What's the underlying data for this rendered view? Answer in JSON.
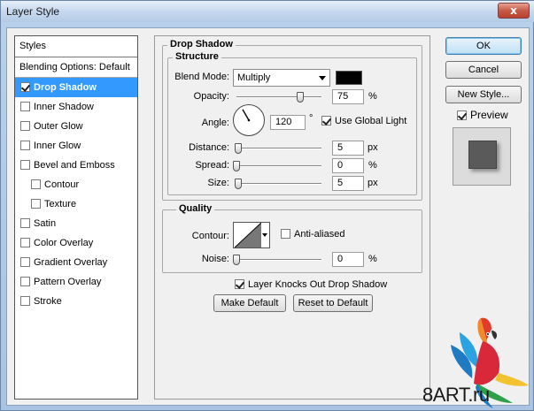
{
  "window": {
    "title": "Layer Style",
    "close_glyph": "x"
  },
  "styles_list": {
    "header": "Styles",
    "blending": "Blending Options: Default",
    "items": [
      {
        "label": "Drop Shadow",
        "checked": true,
        "active": true,
        "indent": false
      },
      {
        "label": "Inner Shadow",
        "checked": false,
        "active": false,
        "indent": false
      },
      {
        "label": "Outer Glow",
        "checked": false,
        "active": false,
        "indent": false
      },
      {
        "label": "Inner Glow",
        "checked": false,
        "active": false,
        "indent": false
      },
      {
        "label": "Bevel and Emboss",
        "checked": false,
        "active": false,
        "indent": false
      },
      {
        "label": "Contour",
        "checked": false,
        "active": false,
        "indent": true
      },
      {
        "label": "Texture",
        "checked": false,
        "active": false,
        "indent": true
      },
      {
        "label": "Satin",
        "checked": false,
        "active": false,
        "indent": false
      },
      {
        "label": "Color Overlay",
        "checked": false,
        "active": false,
        "indent": false
      },
      {
        "label": "Gradient Overlay",
        "checked": false,
        "active": false,
        "indent": false
      },
      {
        "label": "Pattern Overlay",
        "checked": false,
        "active": false,
        "indent": false
      },
      {
        "label": "Stroke",
        "checked": false,
        "active": false,
        "indent": false
      }
    ]
  },
  "drop_shadow": {
    "title": "Drop Shadow",
    "structure": {
      "title": "Structure",
      "blend_mode_label": "Blend Mode:",
      "blend_mode_value": "Multiply",
      "shadow_color": "#000000",
      "opacity_label": "Opacity:",
      "opacity_value": "75",
      "opacity_unit": "%",
      "opacity_fraction": 0.75,
      "angle_label": "Angle:",
      "angle_value": "120",
      "angle_unit": "°",
      "use_global_light_label": "Use Global Light",
      "use_global_light": true,
      "distance_label": "Distance:",
      "distance_value": "5",
      "distance_unit": "px",
      "distance_fraction": 0.02,
      "spread_label": "Spread:",
      "spread_value": "0",
      "spread_unit": "%",
      "spread_fraction": 0.0,
      "size_label": "Size:",
      "size_value": "5",
      "size_unit": "px",
      "size_fraction": 0.02
    },
    "quality": {
      "title": "Quality",
      "contour_label": "Contour:",
      "anti_aliased_label": "Anti-aliased",
      "anti_aliased": false,
      "noise_label": "Noise:",
      "noise_value": "0",
      "noise_unit": "%",
      "noise_fraction": 0.0
    },
    "layer_knocks_out_label": "Layer Knocks Out Drop Shadow",
    "layer_knocks_out": true,
    "make_default_label": "Make Default",
    "reset_default_label": "Reset to Default"
  },
  "buttons": {
    "ok": "OK",
    "cancel": "Cancel",
    "new_style": "New Style...",
    "preview_label": "Preview",
    "preview_checked": true
  },
  "watermark": {
    "text": "8ART.ru"
  }
}
